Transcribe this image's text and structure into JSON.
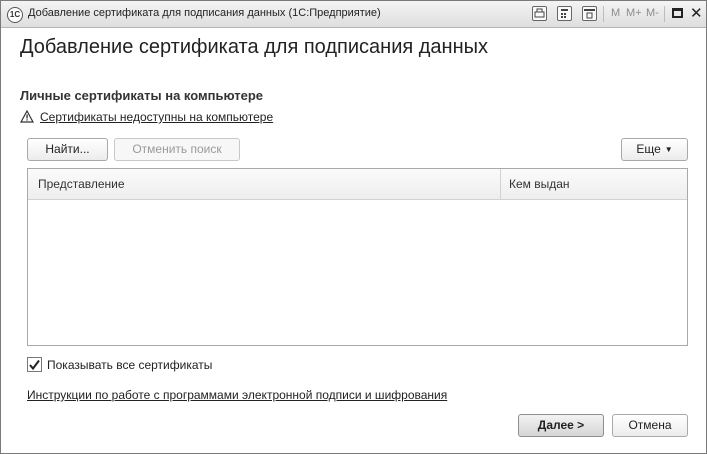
{
  "window": {
    "title": "Добавление сертификата для подписания данных  (1С:Предприятие)",
    "logo_text": "1С",
    "toolbar": {
      "m_label": "M",
      "mplus_label": "M+",
      "mminus_label": "M-",
      "close_glyph": "✕"
    }
  },
  "page": {
    "title": "Добавление сертификата для подписания данных",
    "section_title": "Личные сертификаты на компьютере",
    "warning_link": "Сертификаты недоступны на компьютере"
  },
  "buttons": {
    "find": "Найти...",
    "cancel_search": "Отменить поиск",
    "more": "Еще",
    "next": "Далее >",
    "cancel": "Отмена"
  },
  "table": {
    "columns": [
      "Представление",
      "Кем выдан"
    ],
    "rows": []
  },
  "checkbox": {
    "label": "Показывать все сертификаты",
    "checked": true
  },
  "instructions_link": "Инструкции по работе с программами электронной подписи и шифрования"
}
